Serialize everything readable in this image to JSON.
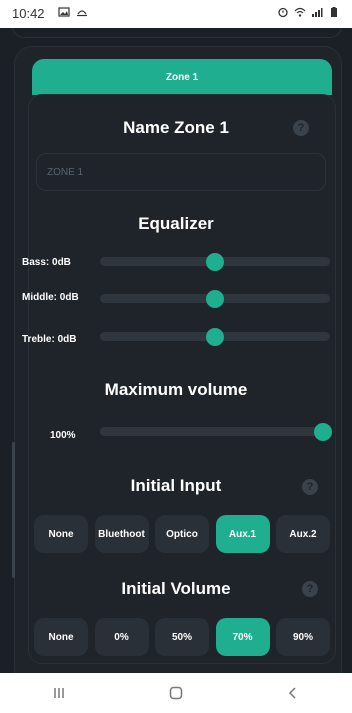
{
  "status_bar": {
    "time": "10:42",
    "left_icons": [
      "image-icon",
      "weather-icon"
    ],
    "right_icons": [
      "alarm-icon",
      "wifi-icon",
      "signal-icon",
      "battery-icon"
    ]
  },
  "zone_tab": {
    "label": "Zone 1"
  },
  "name_section": {
    "title": "Name Zone 1",
    "help": "?",
    "input_placeholder": "ZONE 1",
    "input_value": ""
  },
  "equalizer": {
    "title": "Equalizer",
    "bands": [
      {
        "label": "Bass: 0dB",
        "value_db": 0
      },
      {
        "label": "Middle: 0dB",
        "value_db": 0
      },
      {
        "label": "Treble: 0dB",
        "value_db": 0
      }
    ]
  },
  "max_volume": {
    "title": "Maximum volume",
    "label": "100%",
    "value_fraction": 1.0
  },
  "initial_input": {
    "title": "Initial Input",
    "help": "?",
    "options": [
      "None",
      "Bluethoot",
      "Optico",
      "Aux.1",
      "Aux.2"
    ],
    "selected": "Aux.1"
  },
  "initial_volume": {
    "title": "Initial Volume",
    "help": "?",
    "options": [
      "None",
      "0%",
      "50%",
      "70%",
      "90%"
    ],
    "selected": "70%"
  },
  "colors": {
    "accent": "#1fae8f",
    "background": "#1b2026",
    "card": "#1e242a",
    "button": "#2a3038"
  },
  "nav_bar": {
    "icons": [
      "recents-icon",
      "home-icon",
      "back-icon"
    ]
  }
}
